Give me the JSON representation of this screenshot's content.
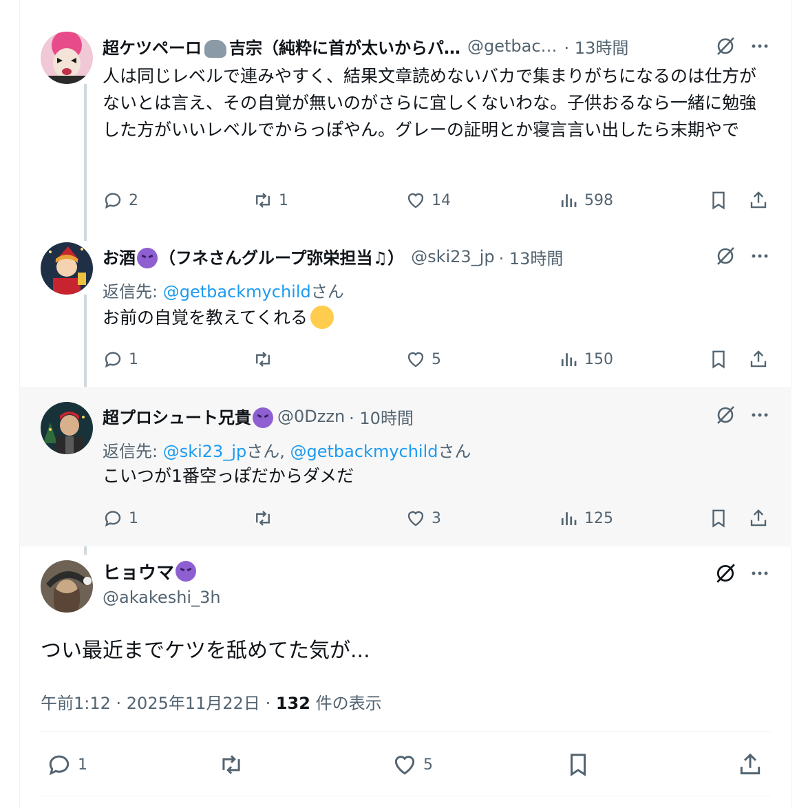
{
  "tweets": [
    {
      "name": "超ケツペーロ",
      "name_rest": "吉宗（純粋に首が太いからパ…",
      "handle": "@getbac…",
      "time": "· 13時間",
      "text": "人は同じレベルで連みやすく、結果文章読めないバカで集まりがちになるのは仕方がないとは言え、その自覚が無いのがさらに宜しくないわな。子供おるなら一緒に勉強した方がいいレベルでからっぽやん。グレーの証明とか寝言言い出したら末期やで",
      "replies": "2",
      "retweets": "1",
      "likes": "14",
      "views": "598"
    },
    {
      "name": "お酒",
      "name_rest": "（フネさんグループ弥栄担当♫）",
      "handle": "@ski23_jp",
      "time": "· 13時間",
      "reply_label": "返信先: ",
      "reply_links": "@getbackmychild",
      "reply_suffix": "さん",
      "text": "お前の自覚を教えてくれる",
      "replies": "1",
      "retweets": "",
      "likes": "5",
      "views": "150"
    },
    {
      "name": "超プロシュート兄貴",
      "handle": "@0Dzzn",
      "time": "· 10時間",
      "reply_label": "返信先: ",
      "reply_link1": "@ski23_jp",
      "reply_mid": "さん, ",
      "reply_link2": "@getbackmychild",
      "reply_suffix": "さん",
      "text": "こいつが1番空っぽだからダメだ",
      "replies": "1",
      "retweets": "",
      "likes": "3",
      "views": "125"
    }
  ],
  "main": {
    "name": "ヒョウマ",
    "handle": "@akakeshi_3h",
    "text": "つい最近までケツを舐めてた気が...",
    "time": "午前1:12 · 2025年11月22日 · ",
    "view_count": "132",
    "view_label": " 件の表示",
    "replies": "1",
    "likes": "5"
  },
  "icons": {
    "reply": "reply-icon",
    "retweet": "retweet-icon",
    "like": "heart-icon",
    "views": "views-icon",
    "bookmark": "bookmark-icon",
    "share": "share-icon",
    "grok": "grok-icon",
    "more": "more-icon"
  },
  "colors": {
    "link": "#1d9bf0",
    "secondary": "#536471",
    "thread_line": "#cfd9de",
    "highlight_bg": "#f7f7f7"
  }
}
